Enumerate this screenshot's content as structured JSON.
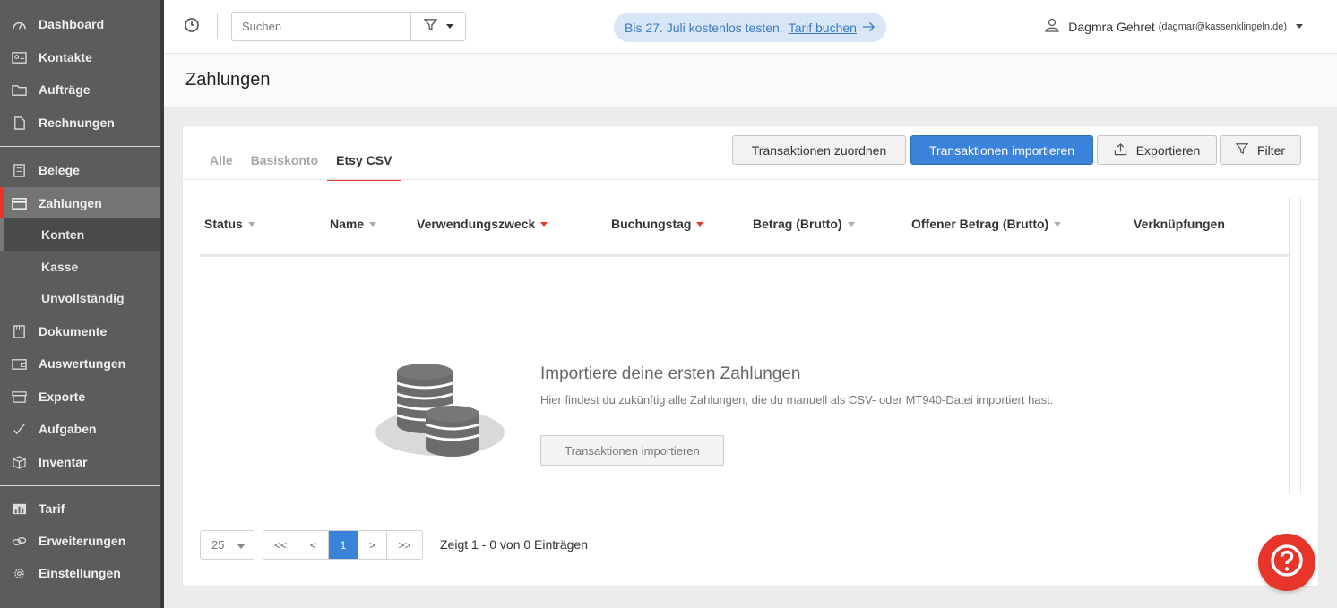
{
  "sidebar": {
    "items": [
      {
        "label": "Dashboard",
        "icon": "dashboard-icon"
      },
      {
        "label": "Kontakte",
        "icon": "contacts-icon"
      },
      {
        "label": "Aufträge",
        "icon": "folder-icon"
      },
      {
        "label": "Rechnungen",
        "icon": "document-icon"
      },
      {
        "label": "Belege",
        "icon": "receipt-icon"
      },
      {
        "label": "Zahlungen",
        "icon": "credit-card-icon"
      },
      {
        "label": "Dokumente",
        "icon": "documents-icon"
      },
      {
        "label": "Auswertungen",
        "icon": "wallet-icon"
      },
      {
        "label": "Exporte",
        "icon": "export-icon"
      },
      {
        "label": "Aufgaben",
        "icon": "checkmark-icon"
      },
      {
        "label": "Inventar",
        "icon": "box-icon"
      },
      {
        "label": "Tarif",
        "icon": "bar-chart-icon"
      },
      {
        "label": "Erweiterungen",
        "icon": "link-icon"
      },
      {
        "label": "Einstellungen",
        "icon": "gear-icon"
      }
    ],
    "subitems": [
      {
        "label": "Konten"
      },
      {
        "label": "Kasse"
      },
      {
        "label": "Unvollständig"
      }
    ]
  },
  "topbar": {
    "search_placeholder": "Suchen",
    "promo_text": "Bis 27. Juli kostenlos testen.",
    "promo_link": "Tarif buchen",
    "user_name": "Dagmra Gehret",
    "user_email": "(dagmar@kassenklingeln.de)"
  },
  "page": {
    "title": "Zahlungen"
  },
  "tabs": [
    "Alle",
    "Basiskonto",
    "Etsy CSV"
  ],
  "toolbar": {
    "assign": "Transaktionen zuordnen",
    "import": "Transaktionen importieren",
    "export": "Exportieren",
    "filter": "Filter"
  },
  "table": {
    "columns": [
      "Status",
      "Name",
      "Verwendungszweck",
      "Buchungstag",
      "Betrag (Brutto)",
      "Offener Betrag (Brutto)",
      "Verknüpfungen"
    ]
  },
  "empty": {
    "title": "Importiere deine ersten Zahlungen",
    "text": "Hier findest du zukünftig alle Zahlungen, die du manuell als CSV- oder MT940-Datei importiert hast.",
    "button": "Transaktionen importieren"
  },
  "pagination": {
    "page_size": "25",
    "first": "<<",
    "prev": "<",
    "current": "1",
    "next": ">",
    "last": ">>",
    "summary": "Zeigt 1 - 0 von 0 Einträgen"
  },
  "colors": {
    "accent_red": "#e8352b",
    "primary_blue": "#3a83d8",
    "sidebar_bg": "#5c5c5c"
  }
}
